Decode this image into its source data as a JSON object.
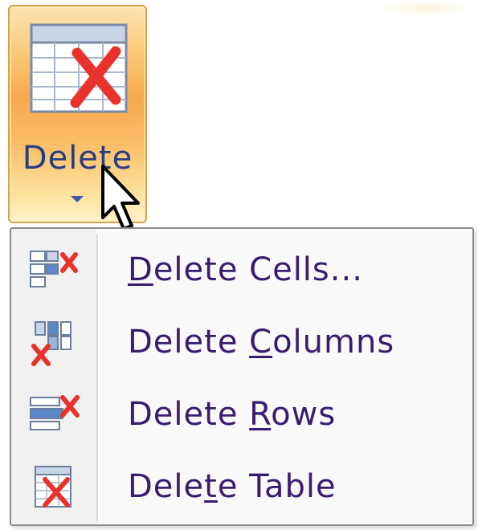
{
  "ribbon": {
    "delete_button": {
      "label": "Delete",
      "icon": "delete-table-icon",
      "state": "pressed"
    }
  },
  "menu": {
    "items": [
      {
        "pre": "",
        "key": "D",
        "post": "elete Cells...",
        "icon": "delete-cells-icon"
      },
      {
        "pre": "Delete ",
        "key": "C",
        "post": "olumns",
        "icon": "delete-columns-icon"
      },
      {
        "pre": "Delete ",
        "key": "R",
        "post": "ows",
        "icon": "delete-rows-icon"
      },
      {
        "pre": "Dele",
        "key": "t",
        "post": "e Table",
        "icon": "delete-table-icon"
      }
    ]
  },
  "colors": {
    "button_accent": "#f6a94f",
    "menu_text": "#3a1b6f",
    "ribbon_text": "#2a3b86",
    "delete_red": "#e8322b"
  }
}
